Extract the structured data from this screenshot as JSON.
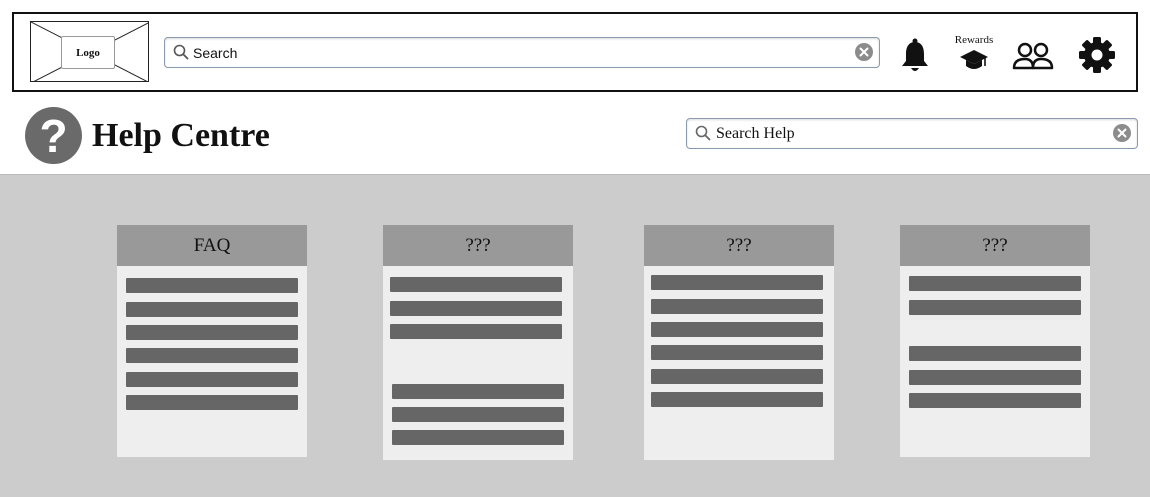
{
  "header": {
    "logo_label": "Logo",
    "search": {
      "placeholder": "Search"
    },
    "rewards_label": "Rewards"
  },
  "help": {
    "title": "Help Centre",
    "search": {
      "placeholder": "Search Help"
    }
  },
  "cards": [
    {
      "title": "FAQ",
      "link_count": 6
    },
    {
      "title": "???",
      "link_count": 6
    },
    {
      "title": "???",
      "link_count": 6
    },
    {
      "title": "???",
      "link_count": 5
    }
  ],
  "icons": {
    "search": "search-icon",
    "clear": "close-circle-icon",
    "bell": "bell-icon",
    "rewards": "graduation-cap-icon",
    "users": "users-icon",
    "settings": "gear-icon",
    "help": "question-mark-icon"
  },
  "colors": {
    "content_background": "#cccccc",
    "card_background": "#eeeeee",
    "card_header": "#999999",
    "placeholder_line": "#666666"
  }
}
